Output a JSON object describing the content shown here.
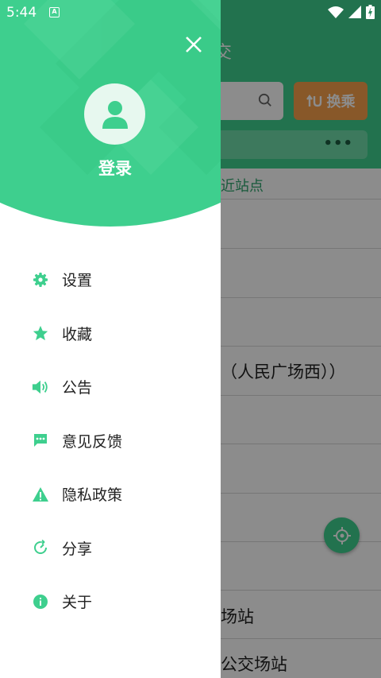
{
  "status_bar": {
    "time": "5:44",
    "notification_icon": "A"
  },
  "background_app": {
    "title": "交",
    "transfer_button": "换乘",
    "more": "•••",
    "nearby_label": "近站点",
    "rows": [
      "（人民广场西））",
      "场站",
      "公交场站"
    ]
  },
  "drawer": {
    "login_label": "登录",
    "menu": [
      {
        "label": "设置",
        "icon": "gear-icon"
      },
      {
        "label": "收藏",
        "icon": "star-icon"
      },
      {
        "label": "公告",
        "icon": "speaker-icon"
      },
      {
        "label": "意见反馈",
        "icon": "feedback-icon"
      },
      {
        "label": "隐私政策",
        "icon": "warning-icon"
      },
      {
        "label": "分享",
        "icon": "share-icon"
      },
      {
        "label": "关于",
        "icon": "info-icon"
      }
    ]
  },
  "colors": {
    "brand_green": "#3ecf8e",
    "transfer_orange": "#f7a04b",
    "icon_green": "#3ecf8e"
  }
}
